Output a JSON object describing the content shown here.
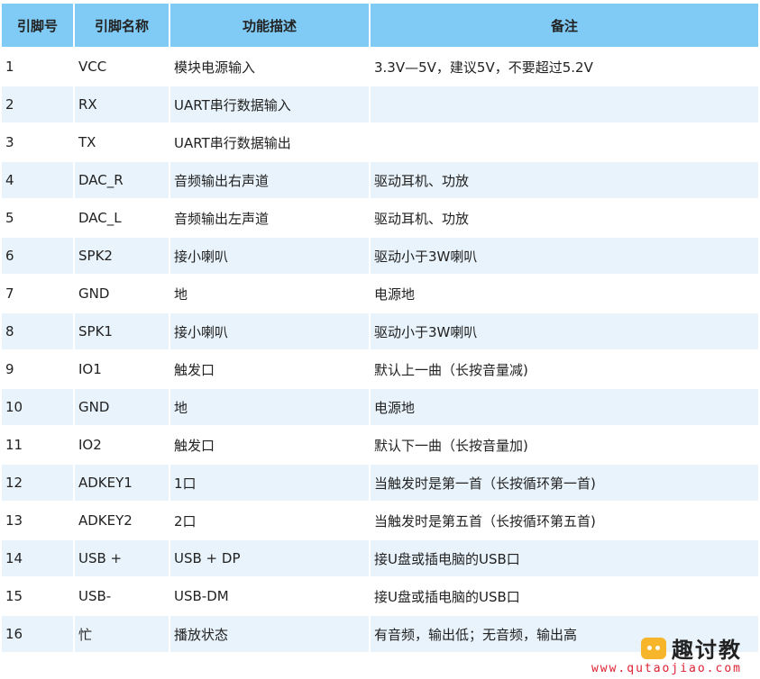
{
  "table": {
    "headers": [
      "引脚号",
      "引脚名称",
      "功能描述",
      "备注"
    ],
    "rows": [
      [
        "1",
        "VCC",
        "模块电源输入",
        "3.3V—5V，建议5V，不要超过5.2V"
      ],
      [
        "2",
        "RX",
        "UART串行数据输入",
        ""
      ],
      [
        "3",
        "TX",
        "UART串行数据输出",
        ""
      ],
      [
        "4",
        "DAC_R",
        "音频输出右声道",
        "驱动耳机、功放"
      ],
      [
        "5",
        "DAC_L",
        "音频输出左声道",
        "驱动耳机、功放"
      ],
      [
        "6",
        "SPK2",
        "接小喇叭",
        "驱动小于3W喇叭"
      ],
      [
        "7",
        "GND",
        "地",
        "电源地"
      ],
      [
        "8",
        "SPK1",
        "接小喇叭",
        "驱动小于3W喇叭"
      ],
      [
        "9",
        "IO1",
        "触发口",
        "默认上一曲（长按音量减)"
      ],
      [
        "10",
        "GND",
        "地",
        "电源地"
      ],
      [
        "11",
        "IO2",
        "触发口",
        "默认下一曲（长按音量加)"
      ],
      [
        "12",
        "ADKEY1",
        "1口",
        "当触发时是第一首（长按循环第一首)"
      ],
      [
        "13",
        "ADKEY2",
        "2口",
        "当触发时是第五首（长按循环第五首)"
      ],
      [
        "14",
        "USB +",
        "USB + DP",
        "接U盘或插电脑的USB口"
      ],
      [
        "15",
        "USB-",
        "USB-DM",
        "接U盘或插电脑的USB口"
      ],
      [
        "16",
        "忙",
        "播放状态",
        "有音频，输出低；无音频，输出高"
      ]
    ]
  },
  "watermark": {
    "logo_text": "趣讨教",
    "url": "www.qutaojiao.com"
  }
}
